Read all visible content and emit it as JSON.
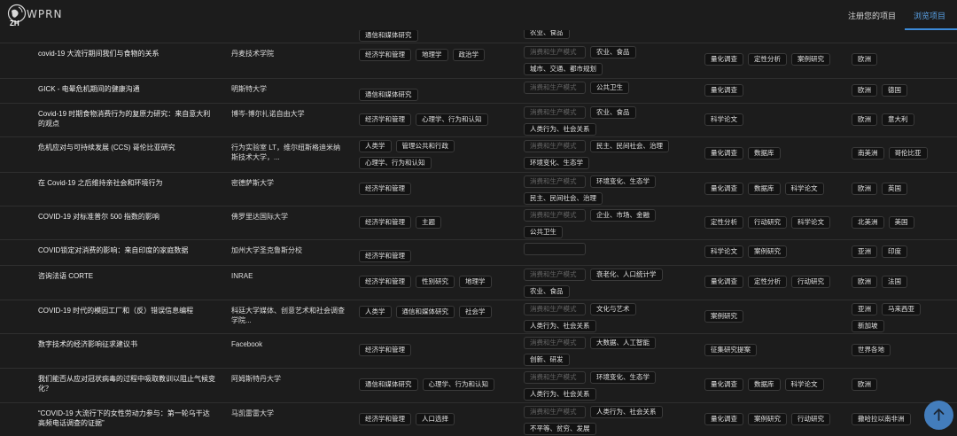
{
  "header": {
    "logo_text": "WPRN",
    "logo_sub": "ZH",
    "nav_register": "注册您的项目",
    "nav_browse": "浏览项目"
  },
  "placeholder": "消费和生产模式",
  "rows": [
    {
      "title": "",
      "org": "",
      "disciplines": [
        "通信和媒体研究"
      ],
      "production": {
        "show_placeholder": false,
        "tags": [
          "农业、食品"
        ]
      },
      "methods": [],
      "geo": []
    },
    {
      "title": "covid-19 大流行期间我们与食物的关系",
      "org": "丹麦技术学院",
      "disciplines": [
        "经济学和管理",
        "地理学",
        "政治学"
      ],
      "production": {
        "show_placeholder": true,
        "tags": [
          "农业、食品",
          "城市、交通、都市规划"
        ]
      },
      "methods": [
        "量化调查",
        "定性分析",
        "案例研究"
      ],
      "geo": [
        "欧洲"
      ]
    },
    {
      "title": "GICK - 电晕危机期间的健康沟通",
      "org": "明斯特大学",
      "disciplines": [
        "通信和媒体研究"
      ],
      "production": {
        "show_placeholder": true,
        "tags": [
          "公共卫生"
        ]
      },
      "methods": [
        "量化调查"
      ],
      "geo": [
        "欧洲",
        "德国"
      ]
    },
    {
      "title": "Covid-19 时期食物消费行为的复原力研究：来自意大利的观点",
      "org": "博岑-博尔扎诺自由大学",
      "disciplines": [
        "经济学和管理",
        "心理学、行为和认知"
      ],
      "production": {
        "show_placeholder": true,
        "tags": [
          "农业、食品",
          "人类行为、社会关系"
        ]
      },
      "methods": [
        "科学论文"
      ],
      "geo": [
        "欧洲",
        "意大利"
      ]
    },
    {
      "title": "危机应对与可持续发展 (CCS) 哥伦比亚研究",
      "org": "行为实验室 LT，维尔纽斯格迪米纳斯技术大学，...",
      "disciplines": [
        "人类学",
        "管理公共和行政",
        "心理学、行为和认知"
      ],
      "production": {
        "show_placeholder": true,
        "tags": [
          "民主、民间社会、治理",
          "环境变化、生态学"
        ]
      },
      "methods": [
        "量化调查",
        "数据库"
      ],
      "geo": [
        "南美洲",
        "哥伦比亚"
      ]
    },
    {
      "title": "在 Covid-19 之后维持亲社会和环境行为",
      "org": "密德萨斯大学",
      "disciplines": [
        "经济学和管理"
      ],
      "production": {
        "show_placeholder": true,
        "tags": [
          "环境变化、生态学",
          "民主、民间社会、治理"
        ]
      },
      "methods": [
        "量化调查",
        "数据库",
        "科学论文"
      ],
      "geo": [
        "欧洲",
        "英国"
      ]
    },
    {
      "title": "COVID-19 对标准普尔 500 指数的影响",
      "org": "佛罗里达国际大学",
      "disciplines": [
        "经济学和管理",
        "主题"
      ],
      "production": {
        "show_placeholder": true,
        "tags": [
          "企业、市场、金融",
          "公共卫生"
        ]
      },
      "methods": [
        "定性分析",
        "行动研究",
        "科学论文"
      ],
      "geo": [
        "北美洲",
        "美国"
      ]
    },
    {
      "title": "COVID锁定对消费的影响：来自印度的家庭数据",
      "org": "加州大学圣克鲁斯分校",
      "disciplines": [
        "经济学和管理"
      ],
      "production": {
        "show_placeholder": true,
        "placeholder_empty": true,
        "tags": []
      },
      "methods": [
        "科学论文",
        "案例研究"
      ],
      "geo": [
        "亚洲",
        "印度"
      ]
    },
    {
      "title": "咨询法语 CORTE",
      "org": "INRAE",
      "disciplines": [
        "经济学和管理",
        "性别研究",
        "地理学"
      ],
      "production": {
        "show_placeholder": true,
        "tags": [
          "衰老化、人口统计学",
          "农业、食品"
        ]
      },
      "methods": [
        "量化调查",
        "定性分析",
        "行动研究"
      ],
      "geo": [
        "欧洲",
        "法国"
      ]
    },
    {
      "title": "COVID-19 时代的模因工厂和（反）错误信息编程",
      "org": "科廷大学媒体、创意艺术和社会调查学院...",
      "disciplines": [
        "人类学",
        "通信和媒体研究",
        "社会学"
      ],
      "production": {
        "show_placeholder": true,
        "tags": [
          "文化与艺术",
          "人类行为、社会关系"
        ]
      },
      "methods": [
        "案例研究"
      ],
      "geo": [
        "亚洲",
        "马来西亚",
        "新加坡"
      ]
    },
    {
      "title": "数字技术的经济影响征求建议书",
      "org": "Facebook",
      "disciplines": [
        "经济学和管理"
      ],
      "production": {
        "show_placeholder": true,
        "tags": [
          "大数据、人工智能",
          "创新、研发"
        ]
      },
      "methods": [
        "征集研究提案"
      ],
      "geo": [
        "世界各地"
      ]
    },
    {
      "title": "我们能否从应对冠状病毒的过程中吸取教训以阻止气候变化？",
      "org": "阿姆斯特丹大学",
      "disciplines": [
        "通信和媒体研究",
        "心理学、行为和认知"
      ],
      "production": {
        "show_placeholder": true,
        "tags": [
          "环境变化、生态学",
          "人类行为、社会关系"
        ]
      },
      "methods": [
        "量化调查",
        "数据库",
        "科学论文"
      ],
      "geo": [
        "欧洲"
      ]
    },
    {
      "title": "“COVID-19 大流行下的女性劳动力参与：第一轮乌干达高频电话调查的证据”",
      "org": "马凯雷雷大学",
      "disciplines": [
        "经济学和管理",
        "人口选择"
      ],
      "production": {
        "show_placeholder": true,
        "tags": [
          "人类行为、社会关系",
          "不平等、贫穷、发展"
        ]
      },
      "methods": [
        "量化调查",
        "案例研究",
        "行动研究"
      ],
      "geo": [
        "撒哈拉以南非洲"
      ]
    }
  ],
  "icons": {
    "logo": "globe-logo-icon",
    "scroll_top": "arrow-up-icon"
  },
  "colors": {
    "background": "#1c1c1c",
    "accent": "#3c8ad8",
    "tag_bg": "#121212",
    "tag_border": "#3a3a3a"
  }
}
